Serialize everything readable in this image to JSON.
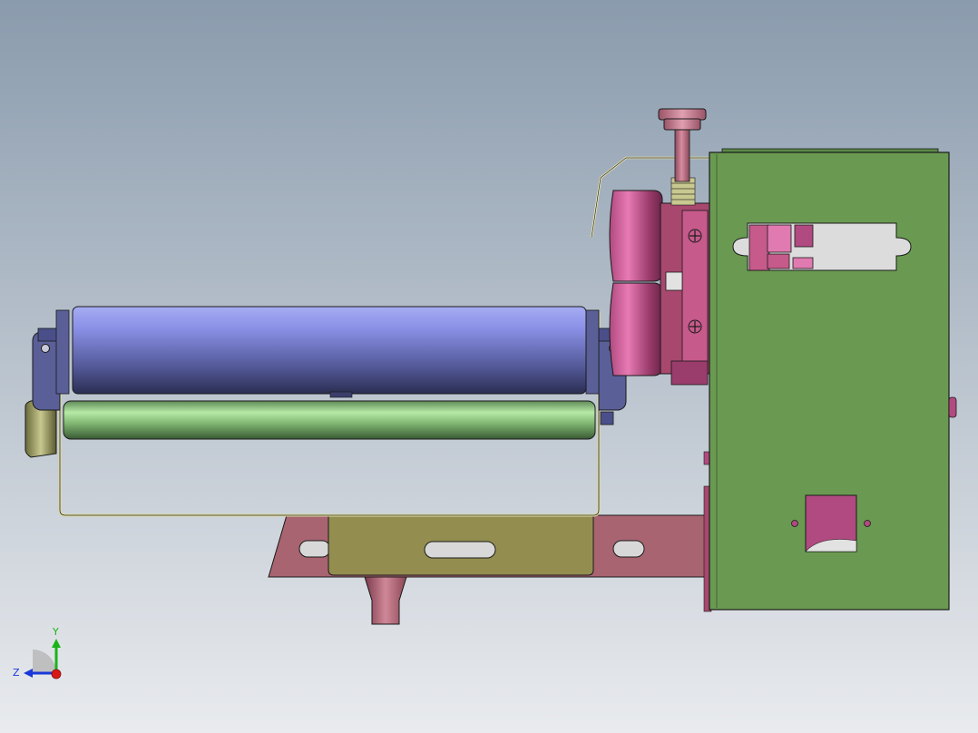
{
  "viewport": {
    "background_top": "#8a9bad",
    "background_bottom": "#e9ebee"
  },
  "triad": {
    "y_label": "Y",
    "z_label": "Z",
    "y_color": "#18b418",
    "z_color": "#1a38d8",
    "x_color": "#d81818"
  },
  "model": {
    "main_plate_color": "#6a9a52",
    "roller_upper_color": "#7b82d8",
    "roller_lower_color": "#86c078",
    "bracket_color": "#4a4f8a",
    "frame_color": "#e0dca0",
    "base_color": "#b06a72",
    "yellow_bracket_color": "#938e50",
    "pink_parts_color": "#c8588e",
    "knob_color": "#b8687a",
    "sensor_color": "#b04a80",
    "edge_color": "#1a1a1a"
  }
}
